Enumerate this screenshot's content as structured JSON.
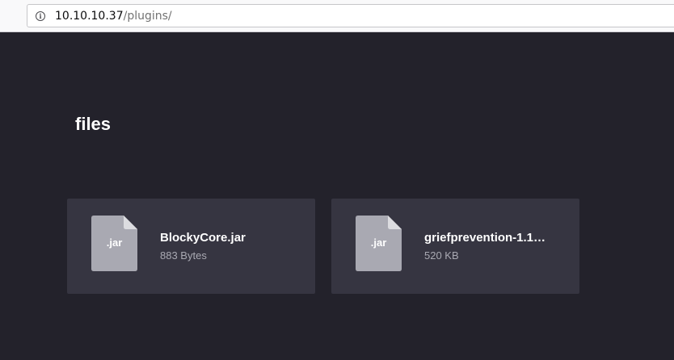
{
  "browser": {
    "url_host": "10.10.10.37",
    "url_path": "/plugins/",
    "info_icon": "info-icon"
  },
  "page": {
    "title": "files"
  },
  "files": [
    {
      "ext": ".jar",
      "name": "BlockyCore.jar",
      "size": "883 Bytes",
      "icon": "file-icon"
    },
    {
      "ext": ".jar",
      "name": "griefprevention-1.1…",
      "size": "520 KB",
      "icon": "file-icon"
    }
  ],
  "colors": {
    "background": "#23222b",
    "card": "#363541",
    "file_icon": "#a9a9b2",
    "text_primary": "#ffffff",
    "text_secondary": "#a9a9b2"
  }
}
